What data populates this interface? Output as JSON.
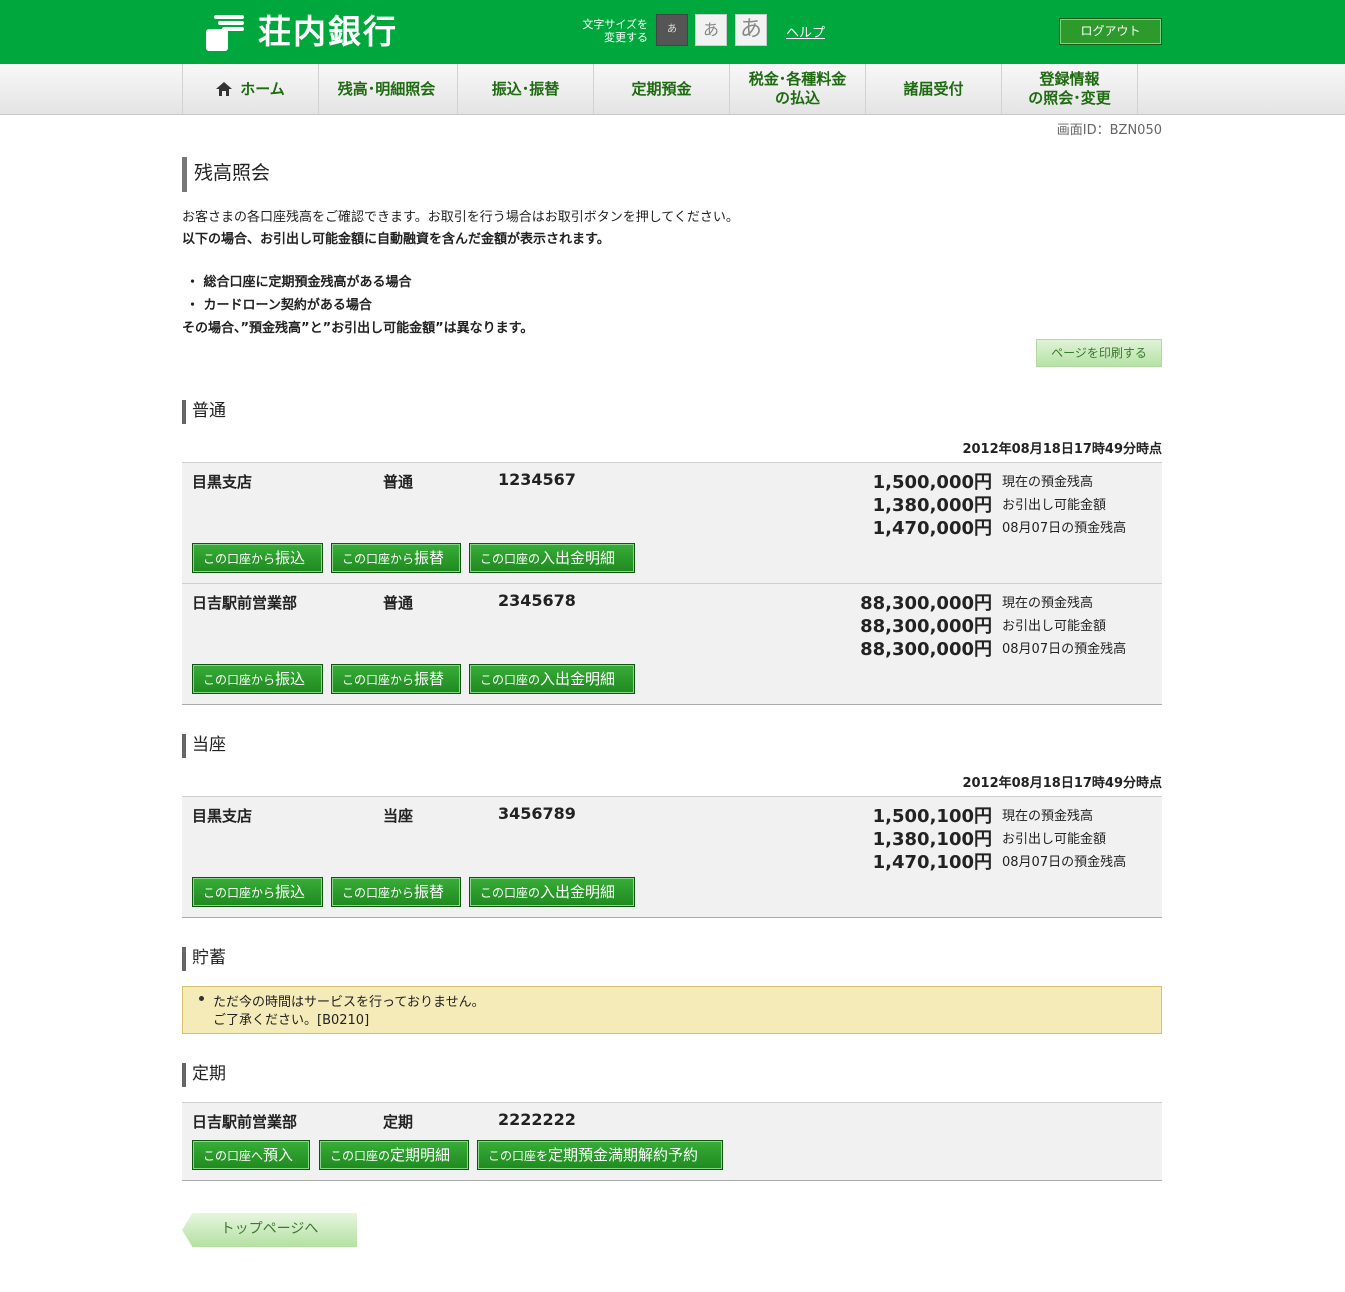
{
  "header": {
    "logo_text": "荘内銀行",
    "fontsize_label_1": "文字サイズを",
    "fontsize_label_2": "変更する",
    "fs_small": "あ",
    "fs_mid": "あ",
    "fs_big": "あ",
    "help": "ヘルプ",
    "logout": "ログアウト"
  },
  "nav": {
    "home": "ホーム",
    "balance": "残高･明細照会",
    "transfer": "振込･振替",
    "time_deposit": "定期預金",
    "tax_1": "税金･各種料金",
    "tax_2": "の払込",
    "notifications": "諸届受付",
    "reg_1": "登録情報",
    "reg_2": "の照会･変更"
  },
  "screen_id": "画面ID：BZN050",
  "page": {
    "title": "残高照会",
    "intro1": "お客さまの各口座残高をご確認できます。お取引を行う場合はお取引ボタンを押してください。",
    "intro2": "以下の場合、お引出し可能金額に自動融資を含んだ金額が表示されます。",
    "bullet1": "・ 総合口座に定期預金残高がある場合",
    "bullet2": "・ カードローン契約がある場合",
    "intro3": "その場合、”預金残高”と”お引出し可能金額”は異なります。",
    "print": "ページを印刷する"
  },
  "labels": {
    "current": "現在の預金残高",
    "withdrawable": "お引出し可能金額",
    "past": "08月07日の預金残高",
    "btn_from_small": "この口座から",
    "btn_transfer": "振込",
    "btn_internal": "振替",
    "btn_detail_small": "この口座の",
    "btn_detail": "入出金明細"
  },
  "ordinary": {
    "title": "普通",
    "timestamp": "2012年08月18日17時49分時点",
    "accounts": [
      {
        "branch": "目黒支店",
        "type": "普通",
        "number": "1234567",
        "current": "1,500,000円",
        "withdrawable": "1,380,000円",
        "past": "1,470,000円"
      },
      {
        "branch": "日吉駅前営業部",
        "type": "普通",
        "number": "2345678",
        "current": "88,300,000円",
        "withdrawable": "88,300,000円",
        "past": "88,300,000円"
      }
    ]
  },
  "checking": {
    "title": "当座",
    "timestamp": "2012年08月18日17時49分時点",
    "accounts": [
      {
        "branch": "目黒支店",
        "type": "当座",
        "number": "3456789",
        "current": "1,500,100円",
        "withdrawable": "1,380,100円",
        "past": "1,470,100円"
      }
    ]
  },
  "savings": {
    "title": "貯蓄",
    "notice1": "ただ今の時間はサービスを行っておりません。",
    "notice2": "ご了承ください。[B0210]"
  },
  "fixed": {
    "title": "定期",
    "branch": "日吉駅前営業部",
    "type": "定期",
    "number": "2222222",
    "btn1_small": "この口座へ",
    "btn1_big": "預入",
    "btn2_small": "この口座の",
    "btn2_big": "定期明細",
    "btn3_small": "この口座を",
    "btn3_big": "定期預金満期解約予約"
  },
  "footer": {
    "top": "トップページへ"
  }
}
